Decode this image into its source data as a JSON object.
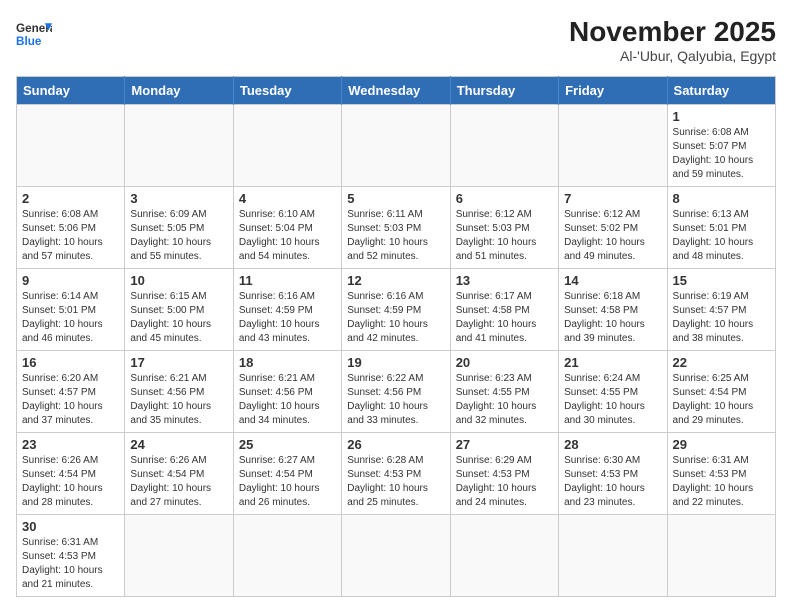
{
  "header": {
    "logo_general": "General",
    "logo_blue": "Blue",
    "title": "November 2025",
    "subtitle": "Al-'Ubur, Qalyubia, Egypt"
  },
  "weekdays": [
    "Sunday",
    "Monday",
    "Tuesday",
    "Wednesday",
    "Thursday",
    "Friday",
    "Saturday"
  ],
  "weeks": [
    [
      {
        "day": "",
        "info": ""
      },
      {
        "day": "",
        "info": ""
      },
      {
        "day": "",
        "info": ""
      },
      {
        "day": "",
        "info": ""
      },
      {
        "day": "",
        "info": ""
      },
      {
        "day": "",
        "info": ""
      },
      {
        "day": "1",
        "info": "Sunrise: 6:08 AM\nSunset: 5:07 PM\nDaylight: 10 hours and 59 minutes."
      }
    ],
    [
      {
        "day": "2",
        "info": "Sunrise: 6:08 AM\nSunset: 5:06 PM\nDaylight: 10 hours and 57 minutes."
      },
      {
        "day": "3",
        "info": "Sunrise: 6:09 AM\nSunset: 5:05 PM\nDaylight: 10 hours and 55 minutes."
      },
      {
        "day": "4",
        "info": "Sunrise: 6:10 AM\nSunset: 5:04 PM\nDaylight: 10 hours and 54 minutes."
      },
      {
        "day": "5",
        "info": "Sunrise: 6:11 AM\nSunset: 5:03 PM\nDaylight: 10 hours and 52 minutes."
      },
      {
        "day": "6",
        "info": "Sunrise: 6:12 AM\nSunset: 5:03 PM\nDaylight: 10 hours and 51 minutes."
      },
      {
        "day": "7",
        "info": "Sunrise: 6:12 AM\nSunset: 5:02 PM\nDaylight: 10 hours and 49 minutes."
      },
      {
        "day": "8",
        "info": "Sunrise: 6:13 AM\nSunset: 5:01 PM\nDaylight: 10 hours and 48 minutes."
      }
    ],
    [
      {
        "day": "9",
        "info": "Sunrise: 6:14 AM\nSunset: 5:01 PM\nDaylight: 10 hours and 46 minutes."
      },
      {
        "day": "10",
        "info": "Sunrise: 6:15 AM\nSunset: 5:00 PM\nDaylight: 10 hours and 45 minutes."
      },
      {
        "day": "11",
        "info": "Sunrise: 6:16 AM\nSunset: 4:59 PM\nDaylight: 10 hours and 43 minutes."
      },
      {
        "day": "12",
        "info": "Sunrise: 6:16 AM\nSunset: 4:59 PM\nDaylight: 10 hours and 42 minutes."
      },
      {
        "day": "13",
        "info": "Sunrise: 6:17 AM\nSunset: 4:58 PM\nDaylight: 10 hours and 41 minutes."
      },
      {
        "day": "14",
        "info": "Sunrise: 6:18 AM\nSunset: 4:58 PM\nDaylight: 10 hours and 39 minutes."
      },
      {
        "day": "15",
        "info": "Sunrise: 6:19 AM\nSunset: 4:57 PM\nDaylight: 10 hours and 38 minutes."
      }
    ],
    [
      {
        "day": "16",
        "info": "Sunrise: 6:20 AM\nSunset: 4:57 PM\nDaylight: 10 hours and 37 minutes."
      },
      {
        "day": "17",
        "info": "Sunrise: 6:21 AM\nSunset: 4:56 PM\nDaylight: 10 hours and 35 minutes."
      },
      {
        "day": "18",
        "info": "Sunrise: 6:21 AM\nSunset: 4:56 PM\nDaylight: 10 hours and 34 minutes."
      },
      {
        "day": "19",
        "info": "Sunrise: 6:22 AM\nSunset: 4:56 PM\nDaylight: 10 hours and 33 minutes."
      },
      {
        "day": "20",
        "info": "Sunrise: 6:23 AM\nSunset: 4:55 PM\nDaylight: 10 hours and 32 minutes."
      },
      {
        "day": "21",
        "info": "Sunrise: 6:24 AM\nSunset: 4:55 PM\nDaylight: 10 hours and 30 minutes."
      },
      {
        "day": "22",
        "info": "Sunrise: 6:25 AM\nSunset: 4:54 PM\nDaylight: 10 hours and 29 minutes."
      }
    ],
    [
      {
        "day": "23",
        "info": "Sunrise: 6:26 AM\nSunset: 4:54 PM\nDaylight: 10 hours and 28 minutes."
      },
      {
        "day": "24",
        "info": "Sunrise: 6:26 AM\nSunset: 4:54 PM\nDaylight: 10 hours and 27 minutes."
      },
      {
        "day": "25",
        "info": "Sunrise: 6:27 AM\nSunset: 4:54 PM\nDaylight: 10 hours and 26 minutes."
      },
      {
        "day": "26",
        "info": "Sunrise: 6:28 AM\nSunset: 4:53 PM\nDaylight: 10 hours and 25 minutes."
      },
      {
        "day": "27",
        "info": "Sunrise: 6:29 AM\nSunset: 4:53 PM\nDaylight: 10 hours and 24 minutes."
      },
      {
        "day": "28",
        "info": "Sunrise: 6:30 AM\nSunset: 4:53 PM\nDaylight: 10 hours and 23 minutes."
      },
      {
        "day": "29",
        "info": "Sunrise: 6:31 AM\nSunset: 4:53 PM\nDaylight: 10 hours and 22 minutes."
      }
    ],
    [
      {
        "day": "30",
        "info": "Sunrise: 6:31 AM\nSunset: 4:53 PM\nDaylight: 10 hours and 21 minutes."
      },
      {
        "day": "",
        "info": ""
      },
      {
        "day": "",
        "info": ""
      },
      {
        "day": "",
        "info": ""
      },
      {
        "day": "",
        "info": ""
      },
      {
        "day": "",
        "info": ""
      },
      {
        "day": "",
        "info": ""
      }
    ]
  ]
}
